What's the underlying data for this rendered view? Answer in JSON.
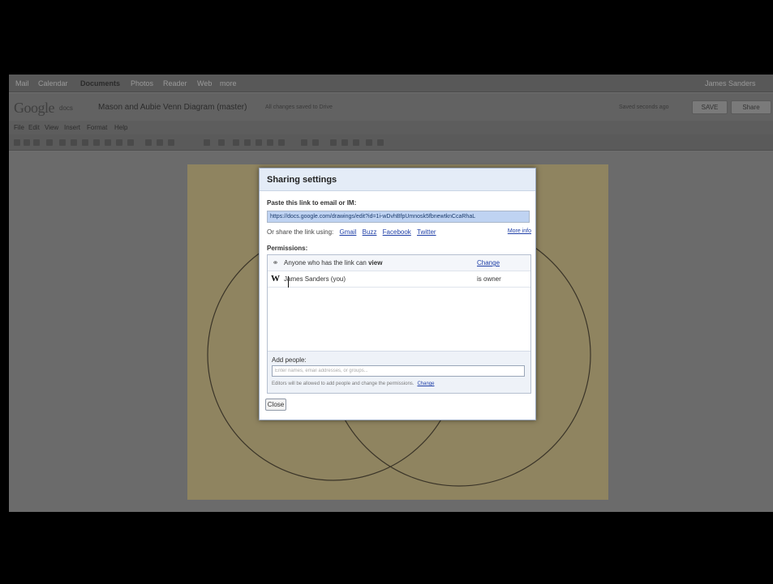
{
  "gbar": {
    "items": [
      "Mail",
      "Calendar",
      "Documents",
      "Photos",
      "Reader",
      "Web",
      "more"
    ],
    "active": "Documents",
    "user": "James Sanders"
  },
  "header": {
    "logo": "Google",
    "logo_sub": "docs",
    "doc_title": "Mason and Aubie Venn Diagram (master)",
    "save_status": "All changes saved to Drive",
    "saved_note": "Saved seconds ago",
    "save_button": "SAVE",
    "share_button": "Share"
  },
  "menubar": {
    "items": [
      "File",
      "Edit",
      "View",
      "Insert",
      "Format",
      "Help"
    ]
  },
  "dialog": {
    "title": "Sharing settings",
    "paste_label": "Paste this link to email or IM:",
    "link_url": "https://docs.google.com/drawings/edit?id=1i-wDvhBfpUmnosk5fbnewtknCcaRhaL",
    "share_prefix": "Or share the link using:",
    "share_links": [
      "Gmail",
      "Buzz",
      "Facebook",
      "Twitter"
    ],
    "learn_more": "More info",
    "permissions_label": "Permissions:",
    "permissions": [
      {
        "text": "Anyone who has the link can ",
        "bold": "view",
        "action": "Change",
        "icon": "link-icon"
      },
      {
        "text": "James Sanders (you)",
        "bold": "",
        "action": "is owner",
        "icon": "user-w-icon"
      }
    ],
    "add_label": "Add people:",
    "add_placeholder": "Enter names, email addresses, or groups...",
    "editor_note": "Editors will be allowed to add people and change the permissions.",
    "editor_change": "Change",
    "close_button": "Close"
  },
  "colors": {
    "drawing_bg": "#8f8460",
    "circle_stroke": "#3a3428",
    "dialog_header": "#e4ecf7",
    "link_blue": "#1f3fa7"
  }
}
